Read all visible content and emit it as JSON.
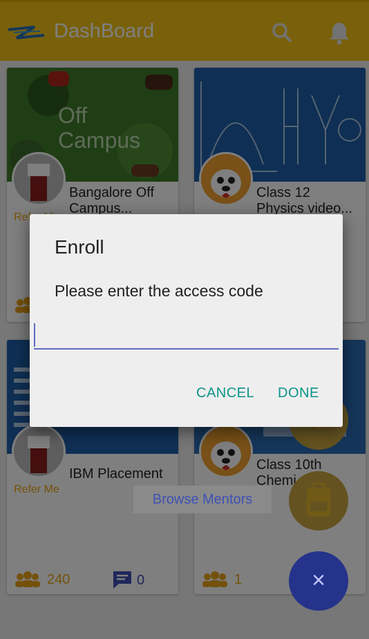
{
  "colors": {
    "appbar": "#f3c316",
    "accent_teal": "#0b9488",
    "indigo": "#3f51b5",
    "orange": "#e8a317"
  },
  "appbar": {
    "title": "DashBoard"
  },
  "cards": [
    {
      "title_line1": "Bangalore Off",
      "title_line2": "Campus...",
      "banner_text_1": "Off",
      "banner_text_2": "Campus",
      "refer": "Refer Me"
    },
    {
      "title_line1": "Class 12",
      "title_line2": "Physics video..."
    },
    {
      "title": "IBM Placement",
      "refer": "Refer Me",
      "members": "240",
      "comments": "0"
    },
    {
      "title_line1": "Class 10th",
      "title_line2": "Chemi",
      "members": "1"
    }
  ],
  "browse_mentors": "Browse Mentors",
  "fab": {
    "close_symbol": "×"
  },
  "dialog": {
    "title": "Enroll",
    "message": "Please enter the access code",
    "input_value": "",
    "cancel_label": "CANCEL",
    "done_label": "DONE"
  }
}
